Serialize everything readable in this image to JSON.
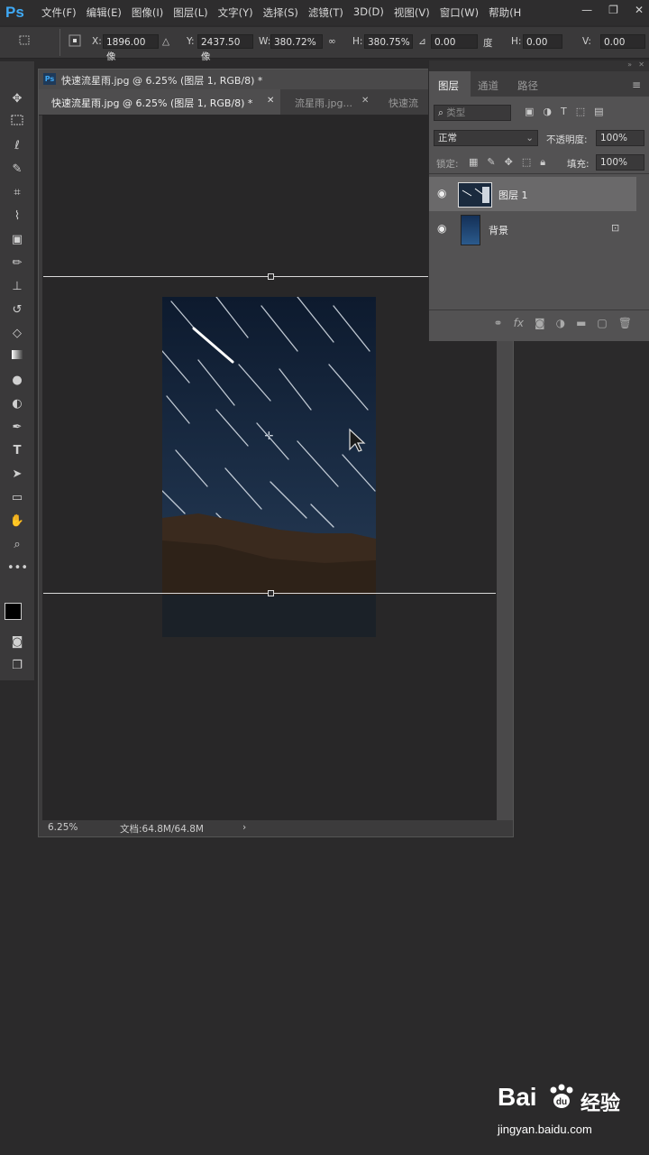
{
  "app": {
    "logo": "Ps",
    "menu": [
      "文件(F)",
      "编辑(E)",
      "图像(I)",
      "图层(L)",
      "文字(Y)",
      "选择(S)",
      "滤镜(T)",
      "3D(D)",
      "视图(V)",
      "窗口(W)",
      "帮助(H"
    ]
  },
  "options": {
    "x_label": "X:",
    "x_value": "1896.00 像",
    "y_label": "Y:",
    "y_value": "2437.50 像",
    "w_label": "W:",
    "w_value": "380.72%",
    "h_label": "H:",
    "h_value": "380.75%",
    "angle_value": "0.00",
    "angle_unit": "度",
    "hskew_label": "H:",
    "hskew_value": "0.00",
    "vskew_label": "V:",
    "vskew_value": "0.00"
  },
  "document": {
    "window_title": "快速流星雨.jpg @ 6.25% (图层 1, RGB/8) *",
    "tabs": [
      {
        "label": "快速流星雨.jpg @ 6.25% (图层 1, RGB/8) *",
        "active": true
      },
      {
        "label": "流星雨.jpg...",
        "active": false
      },
      {
        "label": "快速流",
        "active": false
      }
    ],
    "zoom": "6.25%",
    "doc_size": "文档:64.8M/64.8M",
    "status_arrow": "›"
  },
  "layers_panel": {
    "tabs": [
      "图层",
      "通道",
      "路径"
    ],
    "filter_placeholder": "类型",
    "blend_mode": "正常",
    "opacity_label": "不透明度:",
    "opacity_value": "100%",
    "lock_label": "锁定:",
    "fill_label": "填充:",
    "fill_value": "100%",
    "layers": [
      {
        "name": "图层 1",
        "visible": true,
        "selected": true
      },
      {
        "name": "背景",
        "visible": true,
        "selected": false,
        "locked": true
      }
    ]
  },
  "watermark": {
    "brand": "Bai",
    "brand2": "经验",
    "url": "jingyan.baidu.com"
  },
  "colors": {
    "accent": "#3fa9f5",
    "ui_dark": "#2b2a2b",
    "panel": "#535253"
  }
}
